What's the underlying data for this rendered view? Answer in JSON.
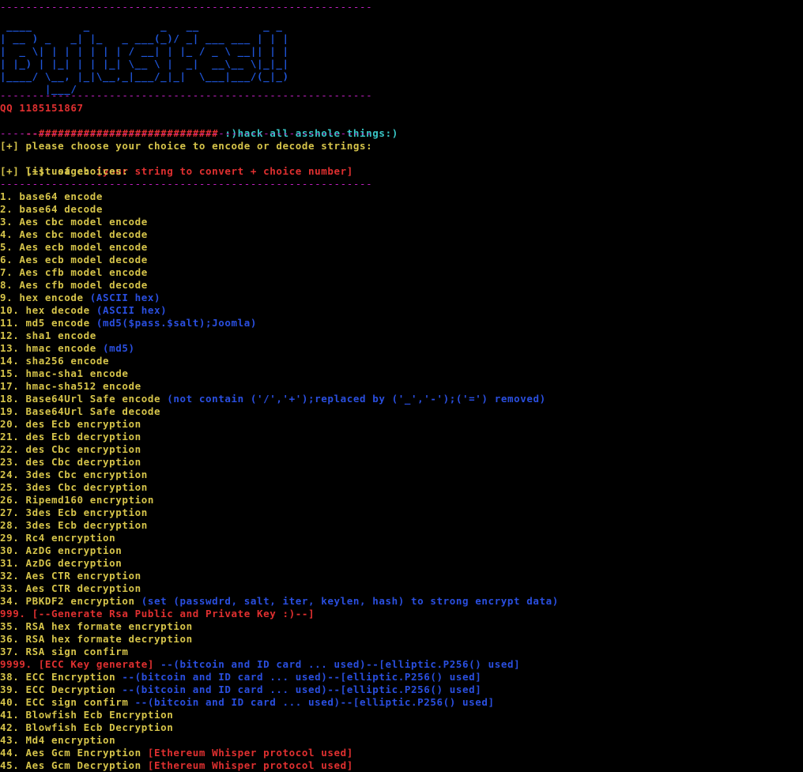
{
  "banner_top": "----------------------------------------------------------",
  "banner": [
    " ____        _           _   __          _ _ ",
    "| __ ) _   _| |_   _ ___(_)/ _| ___ ___ | | |",
    "|  _ \\| | | | | | | / __| | |_ / _ \\ __|| | |",
    "| |_) | |_| | | |_| \\__ \\ |  _|  __\\__ \\|_|_|",
    "|____/ \\__, |_|\\__,_|___/_|_|  \\___|___/(_|_)",
    "       |___/ "
  ],
  "separator": "----------------------------------------------------------",
  "qq": "QQ 1185151867",
  "tagline": {
    "prefix": "--############################ ",
    "text": ":)hack all asshole things:)"
  },
  "intro": [
    {
      "text": "[+] please choose your choice to encode or decode strings:"
    },
    {
      "text": "[+] usage: ",
      "accent": "[your string to convert + choice number]"
    },
    {
      "text": "[+] list of choices:"
    }
  ],
  "choices": [
    {
      "main": "1. base64 encode"
    },
    {
      "main": "2. base64 decode"
    },
    {
      "main": "3. Aes cbc model encode"
    },
    {
      "main": "4. Aes cbc model decode"
    },
    {
      "main": "5. Aes ecb model encode"
    },
    {
      "main": "6. Aes ecb model decode"
    },
    {
      "main": "7. Aes cfb model encode"
    },
    {
      "main": "8. Aes cfb model decode"
    },
    {
      "main": "9. hex encode ",
      "note": "(ASCII hex)"
    },
    {
      "main": "10. hex decode ",
      "note": "(ASCII hex)"
    },
    {
      "main": "11. md5 encode ",
      "note": "(md5($pass.$salt);Joomla)"
    },
    {
      "main": "12. sha1 encode"
    },
    {
      "main": "13. hmac encode ",
      "note": "(md5)"
    },
    {
      "main": "14. sha256 encode"
    },
    {
      "main": "15. hmac-sha1 encode"
    },
    {
      "main": "17. hmac-sha512 encode"
    },
    {
      "main": "18. Base64Url Safe encode ",
      "note": "(not contain ('/','+');replaced by ('_','-');('=') removed)"
    },
    {
      "main": "19. Base64Url Safe decode"
    },
    {
      "main": "20. des Ecb encryption"
    },
    {
      "main": "21. des Ecb decryption"
    },
    {
      "main": "22. des Cbc encryption"
    },
    {
      "main": "23. des Cbc decryption"
    },
    {
      "main": "24. 3des Cbc encryption"
    },
    {
      "main": "25. 3des Cbc decryption"
    },
    {
      "main": "26. Ripemd160 encryption"
    },
    {
      "main": "27. 3des Ecb encryption"
    },
    {
      "main": "28. 3des Ecb decryption"
    },
    {
      "main": "29. Rc4 encryption"
    },
    {
      "main": "30. AzDG encryption"
    },
    {
      "main": "31. AzDG decryption"
    },
    {
      "main": "32. Aes CTR encryption"
    },
    {
      "main": "33. Aes CTR decryption"
    },
    {
      "main": "34. PBKDF2 encryption ",
      "note": "(set (passwdrd, salt, iter, keylen, hash) to strong encrypt data)"
    },
    {
      "red": "999. [--Generate Rsa Public and Private Key :)--]"
    },
    {
      "main": "35. RSA hex formate encryption"
    },
    {
      "main": "36. RSA hex formate decryption"
    },
    {
      "main": "37. RSA sign confirm"
    },
    {
      "red": "9999. [ECC Key generate] ",
      "note": "--(bitcoin and ID card ... used)--[elliptic.P256() used]"
    },
    {
      "main": "38. ECC Encryption ",
      "note": "--(bitcoin and ID card ... used)--[elliptic.P256() used]"
    },
    {
      "main": "39. ECC Decryption ",
      "note": "--(bitcoin and ID card ... used)--[elliptic.P256() used]"
    },
    {
      "main": "40. ECC sign confirm ",
      "note": "--(bitcoin and ID card ... used)--[elliptic.P256() used]"
    },
    {
      "main": "41. Blowfish Ecb Encryption"
    },
    {
      "main": "42. Blowfish Ecb Decryption"
    },
    {
      "main": "43. Md4 encryption"
    },
    {
      "main": "44. Aes Gcm Encryption ",
      "red": "[Ethereum Whisper protocol used]"
    },
    {
      "main": "45. Aes Gcm Decryption ",
      "red": "[Ethereum Whisper protocol used]"
    }
  ],
  "colors": {
    "background": "#000000",
    "banner": "#1f55d8",
    "separator": "#c020c0",
    "red": "#e03030",
    "yellow": "#d6c44a",
    "cyan": "#38c8c8",
    "blue": "#2a4fe0"
  }
}
